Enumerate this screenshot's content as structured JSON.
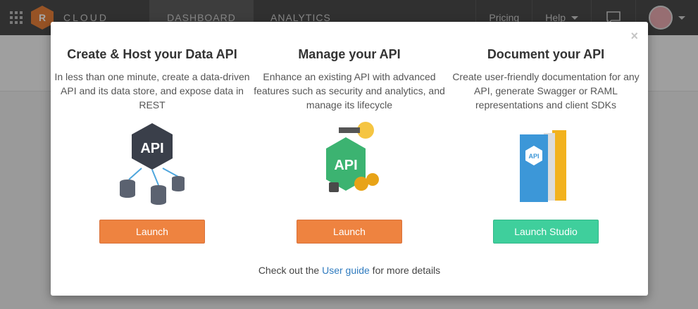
{
  "navbar": {
    "brand_letter": "R",
    "brand": "CLOUD",
    "tabs": [
      {
        "label": "DASHBOARD",
        "active": true
      },
      {
        "label": "ANALYTICS",
        "active": false
      }
    ],
    "pricing": "Pricing",
    "help": "Help"
  },
  "modal": {
    "close": "×",
    "columns": [
      {
        "title": "Create & Host your Data API",
        "description": "In less than one minute, create a data-driven API and its data store, and expose data in REST",
        "button": "Launch",
        "icon": "api-database-icon",
        "button_color": "#ee8340"
      },
      {
        "title": "Manage your API",
        "description": "Enhance an existing API with advanced features such as security and analytics, and manage its lifecycle",
        "button": "Launch",
        "icon": "api-management-icon",
        "button_color": "#ee8340"
      },
      {
        "title": "Document your API",
        "description": "Create user-friendly documentation for any API, generate Swagger or RAML representations and client SDKs",
        "button": "Launch Studio",
        "icon": "api-documentation-icon",
        "button_color": "#3fcf9c"
      }
    ],
    "footer": {
      "prefix": "Check out the ",
      "link": "User guide",
      "suffix": " for more details"
    }
  }
}
